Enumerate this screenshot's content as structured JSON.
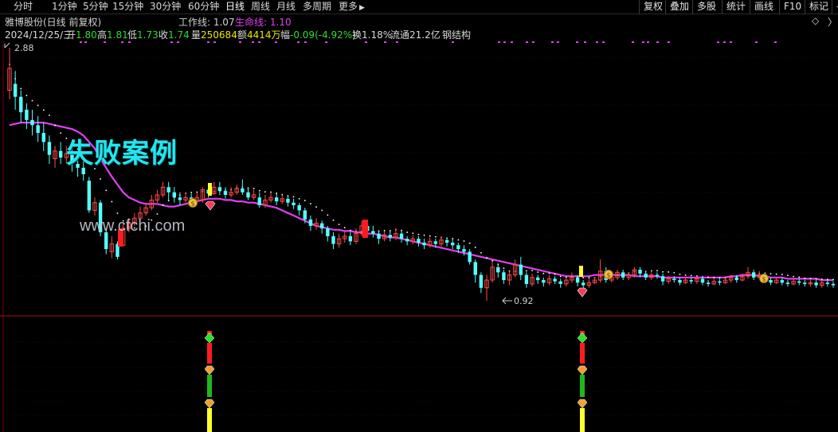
{
  "toolbar": {
    "periods": [
      {
        "label": "分时"
      },
      {
        "label": "1分钟"
      },
      {
        "label": "5分钟"
      },
      {
        "label": "15分钟"
      },
      {
        "label": "30分钟"
      },
      {
        "label": "60分钟"
      },
      {
        "label": "日线"
      },
      {
        "label": "周线"
      },
      {
        "label": "月线"
      },
      {
        "label": "多周期"
      },
      {
        "label": "更多"
      }
    ],
    "more_arrow": "▶",
    "right_buttons": [
      {
        "label": "复权"
      },
      {
        "label": "叠加"
      },
      {
        "label": "多股"
      },
      {
        "label": "统计"
      },
      {
        "label": "画线"
      },
      {
        "label": "F10"
      },
      {
        "label": "标记"
      },
      {
        "label": "-"
      }
    ]
  },
  "header": {
    "stock_title": "雅博股份(日线 前复权)",
    "work_line": "工作线: 1.07",
    "life_line": "生命线: 1.10",
    "diamond": "◇",
    "chevron": "〉",
    "date": "2024/12/25/三",
    "open_label": "开",
    "open": "1.80",
    "high_label": "高",
    "high": "1.81",
    "low_label": "低",
    "low": "1.73",
    "close_label": "收",
    "close": "1.74",
    "volume_label": "量",
    "volume": "250684",
    "amount_label": "额",
    "amount": "4414万",
    "change_label": "幅",
    "change": "-0.09(-4.92%)",
    "turnover": "换1.18%",
    "float_cap": "流通21.2亿",
    "structure": "钢结构"
  },
  "annotations": {
    "watermark": "失败案例",
    "site": "www.cfchi.com",
    "high_label": "2.88",
    "low_label": "0.92"
  },
  "colors": {
    "up": "#ff4b4b",
    "down": "#54ffff",
    "life_line": "#e040f0",
    "work_line": "#ffffff",
    "signal_red": "#ff1c1c",
    "signal_green": "#1eb81e",
    "signal_yellow": "#ffff2a",
    "grid": "#7a0000"
  },
  "chart_data": {
    "type": "candlestick",
    "price_high": 2.88,
    "price_low": 0.92,
    "last_date": "2024/12/25",
    "work_line_last": 1.07,
    "life_line_last": 1.1,
    "candles": [
      [
        2.55,
        2.72,
        2.88,
        2.48
      ],
      [
        2.6,
        2.5,
        2.7,
        2.4
      ],
      [
        2.5,
        2.38,
        2.55,
        2.3
      ],
      [
        2.4,
        2.32,
        2.45,
        2.25
      ],
      [
        2.32,
        2.28,
        2.4,
        2.2
      ],
      [
        2.28,
        2.22,
        2.35,
        2.15
      ],
      [
        2.22,
        2.15,
        2.3,
        2.08
      ],
      [
        2.15,
        2.05,
        2.2,
        1.98
      ],
      [
        2.02,
        2.08,
        2.12,
        1.95
      ],
      [
        2.08,
        2.03,
        2.15,
        1.98
      ],
      [
        2.03,
        2.06,
        2.12,
        1.98
      ],
      [
        2.06,
        1.98,
        2.1,
        1.92
      ],
      [
        1.98,
        1.95,
        2.02,
        1.88
      ],
      [
        1.95,
        1.9,
        2.0,
        1.85
      ],
      [
        1.85,
        1.62,
        1.88,
        1.6
      ],
      [
        1.62,
        1.68,
        1.72,
        1.58
      ],
      [
        1.68,
        1.45,
        1.7,
        1.42
      ],
      [
        1.45,
        1.32,
        1.48,
        1.28
      ],
      [
        1.3,
        1.36,
        1.42,
        1.25
      ],
      [
        1.36,
        1.26,
        1.38,
        1.24
      ],
      [
        1.35,
        1.48,
        1.52,
        1.34
      ],
      [
        1.48,
        1.52,
        1.56,
        1.45
      ],
      [
        1.52,
        1.56,
        1.6,
        1.5
      ],
      [
        1.56,
        1.6,
        1.65,
        1.54
      ],
      [
        1.6,
        1.64,
        1.68,
        1.58
      ],
      [
        1.64,
        1.7,
        1.74,
        1.62
      ],
      [
        1.7,
        1.74,
        1.78,
        1.68
      ],
      [
        1.74,
        1.8,
        1.84,
        1.72
      ],
      [
        1.8,
        1.76,
        1.84,
        1.7
      ],
      [
        1.76,
        1.72,
        1.8,
        1.68
      ],
      [
        1.72,
        1.7,
        1.76,
        1.66
      ],
      [
        1.7,
        1.72,
        1.76,
        1.68
      ],
      [
        1.72,
        1.69,
        1.75,
        1.66
      ],
      [
        1.69,
        1.72,
        1.76,
        1.67
      ],
      [
        1.7,
        1.78,
        1.8,
        1.68
      ],
      [
        1.78,
        1.75,
        1.82,
        1.72
      ],
      [
        1.75,
        1.8,
        1.84,
        1.74
      ],
      [
        1.8,
        1.77,
        1.84,
        1.74
      ],
      [
        1.77,
        1.74,
        1.8,
        1.71
      ],
      [
        1.74,
        1.76,
        1.8,
        1.72
      ],
      [
        1.76,
        1.79,
        1.82,
        1.74
      ],
      [
        1.79,
        1.76,
        1.86,
        1.74
      ],
      [
        1.76,
        1.72,
        1.8,
        1.7
      ],
      [
        1.72,
        1.74,
        1.78,
        1.7
      ],
      [
        1.72,
        1.66,
        1.76,
        1.64
      ],
      [
        1.66,
        1.7,
        1.74,
        1.64
      ],
      [
        1.7,
        1.72,
        1.76,
        1.68
      ],
      [
        1.72,
        1.69,
        1.75,
        1.66
      ],
      [
        1.69,
        1.71,
        1.74,
        1.67
      ],
      [
        1.71,
        1.68,
        1.73,
        1.65
      ],
      [
        1.68,
        1.66,
        1.71,
        1.63
      ],
      [
        1.66,
        1.62,
        1.68,
        1.58
      ],
      [
        1.62,
        1.55,
        1.64,
        1.52
      ],
      [
        1.55,
        1.5,
        1.58,
        1.46
      ],
      [
        1.5,
        1.52,
        1.56,
        1.47
      ],
      [
        1.52,
        1.48,
        1.54,
        1.44
      ],
      [
        1.48,
        1.42,
        1.5,
        1.38
      ],
      [
        1.42,
        1.36,
        1.45,
        1.32
      ],
      [
        1.36,
        1.4,
        1.44,
        1.33
      ],
      [
        1.4,
        1.42,
        1.46,
        1.37
      ],
      [
        1.42,
        1.38,
        1.45,
        1.35
      ],
      [
        1.38,
        1.44,
        1.48,
        1.36
      ],
      [
        1.44,
        1.5,
        1.54,
        1.42
      ],
      [
        1.5,
        1.46,
        1.52,
        1.42
      ],
      [
        1.46,
        1.44,
        1.5,
        1.41
      ],
      [
        1.44,
        1.4,
        1.46,
        1.36
      ],
      [
        1.4,
        1.43,
        1.46,
        1.38
      ],
      [
        1.43,
        1.41,
        1.46,
        1.38
      ],
      [
        1.41,
        1.44,
        1.48,
        1.39
      ],
      [
        1.44,
        1.4,
        1.46,
        1.37
      ],
      [
        1.4,
        1.38,
        1.42,
        1.35
      ],
      [
        1.38,
        1.4,
        1.43,
        1.36
      ],
      [
        1.4,
        1.37,
        1.42,
        1.34
      ],
      [
        1.37,
        1.35,
        1.4,
        1.32
      ],
      [
        1.35,
        1.38,
        1.41,
        1.33
      ],
      [
        1.38,
        1.36,
        1.4,
        1.33
      ],
      [
        1.36,
        1.39,
        1.42,
        1.34
      ],
      [
        1.39,
        1.37,
        1.41,
        1.34
      ],
      [
        1.37,
        1.35,
        1.4,
        1.32
      ],
      [
        1.35,
        1.32,
        1.37,
        1.29
      ],
      [
        1.32,
        1.3,
        1.35,
        1.27
      ],
      [
        1.3,
        1.22,
        1.32,
        1.2
      ],
      [
        1.22,
        1.12,
        1.24,
        1.06
      ],
      [
        1.12,
        1.02,
        1.14,
        0.98
      ],
      [
        1.02,
        1.08,
        1.12,
        0.92
      ],
      [
        1.08,
        1.18,
        1.22,
        1.06
      ],
      [
        1.18,
        1.14,
        1.2,
        1.1
      ],
      [
        1.14,
        1.08,
        1.16,
        1.05
      ],
      [
        1.08,
        1.12,
        1.15,
        1.04
      ],
      [
        1.12,
        1.2,
        1.24,
        1.1
      ],
      [
        1.2,
        1.12,
        1.26,
        1.08
      ],
      [
        1.12,
        1.05,
        1.14,
        1.02
      ],
      [
        1.05,
        1.1,
        1.13,
        1.03
      ],
      [
        1.1,
        1.08,
        1.12,
        1.05
      ],
      [
        1.08,
        1.06,
        1.1,
        1.03
      ],
      [
        1.06,
        1.09,
        1.12,
        1.04
      ],
      [
        1.09,
        1.07,
        1.11,
        1.05
      ],
      [
        1.07,
        1.05,
        1.09,
        1.02
      ],
      [
        1.05,
        1.08,
        1.1,
        1.03
      ],
      [
        1.08,
        1.1,
        1.14,
        1.06
      ],
      [
        1.1,
        1.06,
        1.12,
        1.03
      ],
      [
        1.06,
        1.04,
        1.08,
        1.02
      ],
      [
        1.04,
        1.06,
        1.09,
        1.02
      ],
      [
        1.06,
        1.08,
        1.1,
        1.05
      ],
      [
        1.08,
        1.15,
        1.24,
        1.06
      ],
      [
        1.15,
        1.08,
        1.18,
        1.06
      ],
      [
        1.08,
        1.1,
        1.13,
        1.06
      ],
      [
        1.1,
        1.14,
        1.16,
        1.08
      ],
      [
        1.14,
        1.1,
        1.16,
        1.08
      ],
      [
        1.1,
        1.12,
        1.14,
        1.08
      ],
      [
        1.12,
        1.16,
        1.18,
        1.1
      ],
      [
        1.16,
        1.13,
        1.18,
        1.1
      ],
      [
        1.13,
        1.1,
        1.15,
        1.08
      ],
      [
        1.1,
        1.12,
        1.14,
        1.08
      ],
      [
        1.12,
        1.11,
        1.14,
        1.09
      ],
      [
        1.11,
        1.07,
        1.13,
        1.04
      ],
      [
        1.07,
        1.09,
        1.11,
        1.05
      ],
      [
        1.09,
        1.08,
        1.11,
        1.06
      ],
      [
        1.08,
        1.06,
        1.1,
        1.04
      ],
      [
        1.06,
        1.08,
        1.1,
        1.05
      ],
      [
        1.08,
        1.07,
        1.1,
        1.05
      ],
      [
        1.07,
        1.09,
        1.11,
        1.05
      ],
      [
        1.09,
        1.06,
        1.11,
        1.04
      ],
      [
        1.06,
        1.05,
        1.08,
        1.03
      ],
      [
        1.05,
        1.07,
        1.09,
        1.04
      ],
      [
        1.07,
        1.06,
        1.09,
        1.04
      ],
      [
        1.06,
        1.08,
        1.1,
        1.05
      ],
      [
        1.08,
        1.1,
        1.12,
        1.06
      ],
      [
        1.1,
        1.08,
        1.12,
        1.06
      ],
      [
        1.08,
        1.11,
        1.13,
        1.07
      ],
      [
        1.11,
        1.14,
        1.18,
        1.09
      ],
      [
        1.14,
        1.1,
        1.16,
        1.08
      ],
      [
        1.1,
        1.12,
        1.15,
        1.09
      ],
      [
        1.12,
        1.08,
        1.14,
        1.06
      ],
      [
        1.08,
        1.06,
        1.1,
        1.04
      ],
      [
        1.06,
        1.08,
        1.1,
        1.05
      ],
      [
        1.08,
        1.06,
        1.1,
        1.04
      ],
      [
        1.06,
        1.05,
        1.08,
        1.03
      ],
      [
        1.05,
        1.07,
        1.09,
        1.04
      ],
      [
        1.07,
        1.06,
        1.09,
        1.04
      ],
      [
        1.06,
        1.05,
        1.08,
        1.03
      ],
      [
        1.05,
        1.06,
        1.08,
        1.03
      ],
      [
        1.06,
        1.04,
        1.08,
        1.02
      ],
      [
        1.04,
        1.06,
        1.08,
        1.02
      ],
      [
        1.06,
        1.05,
        1.08,
        1.03
      ],
      [
        1.05,
        1.04,
        1.07,
        1.02
      ]
    ],
    "life_line": [
      2.28,
      2.29,
      2.3,
      2.3,
      2.3,
      2.3,
      2.3,
      2.29,
      2.28,
      2.27,
      2.26,
      2.25,
      2.23,
      2.2,
      2.15,
      2.1,
      2.02,
      1.95,
      1.88,
      1.82,
      1.76,
      1.72,
      1.7,
      1.68,
      1.67,
      1.67,
      1.67,
      1.66,
      1.65,
      1.65,
      1.66,
      1.67,
      1.68,
      1.69,
      1.7,
      1.71,
      1.71,
      1.71,
      1.7,
      1.7,
      1.69,
      1.69,
      1.68,
      1.68,
      1.67,
      1.66,
      1.65,
      1.64,
      1.62,
      1.6,
      1.58,
      1.56,
      1.54,
      1.52,
      1.5,
      1.49,
      1.48,
      1.47,
      1.47,
      1.46,
      1.46,
      1.45,
      1.45,
      1.44,
      1.44,
      1.43,
      1.42,
      1.41,
      1.41,
      1.4,
      1.39,
      1.38,
      1.37,
      1.36,
      1.35,
      1.34,
      1.33,
      1.32,
      1.31,
      1.3,
      1.29,
      1.28,
      1.27,
      1.26,
      1.25,
      1.24,
      1.23,
      1.22,
      1.21,
      1.2,
      1.19,
      1.18,
      1.17,
      1.16,
      1.15,
      1.14,
      1.13,
      1.12,
      1.11,
      1.11,
      1.11,
      1.11,
      1.11,
      1.12,
      1.12,
      1.12,
      1.12,
      1.12,
      1.12,
      1.12,
      1.11,
      1.11,
      1.11,
      1.11,
      1.11,
      1.1,
      1.1,
      1.1,
      1.1,
      1.1,
      1.1,
      1.1,
      1.1,
      1.1,
      1.1,
      1.1,
      1.1,
      1.11,
      1.11,
      1.12,
      1.12,
      1.12,
      1.11,
      1.11,
      1.1,
      1.1,
      1.1,
      1.09,
      1.09,
      1.09,
      1.09,
      1.09,
      1.09,
      1.08,
      1.08,
      1.08
    ]
  }
}
